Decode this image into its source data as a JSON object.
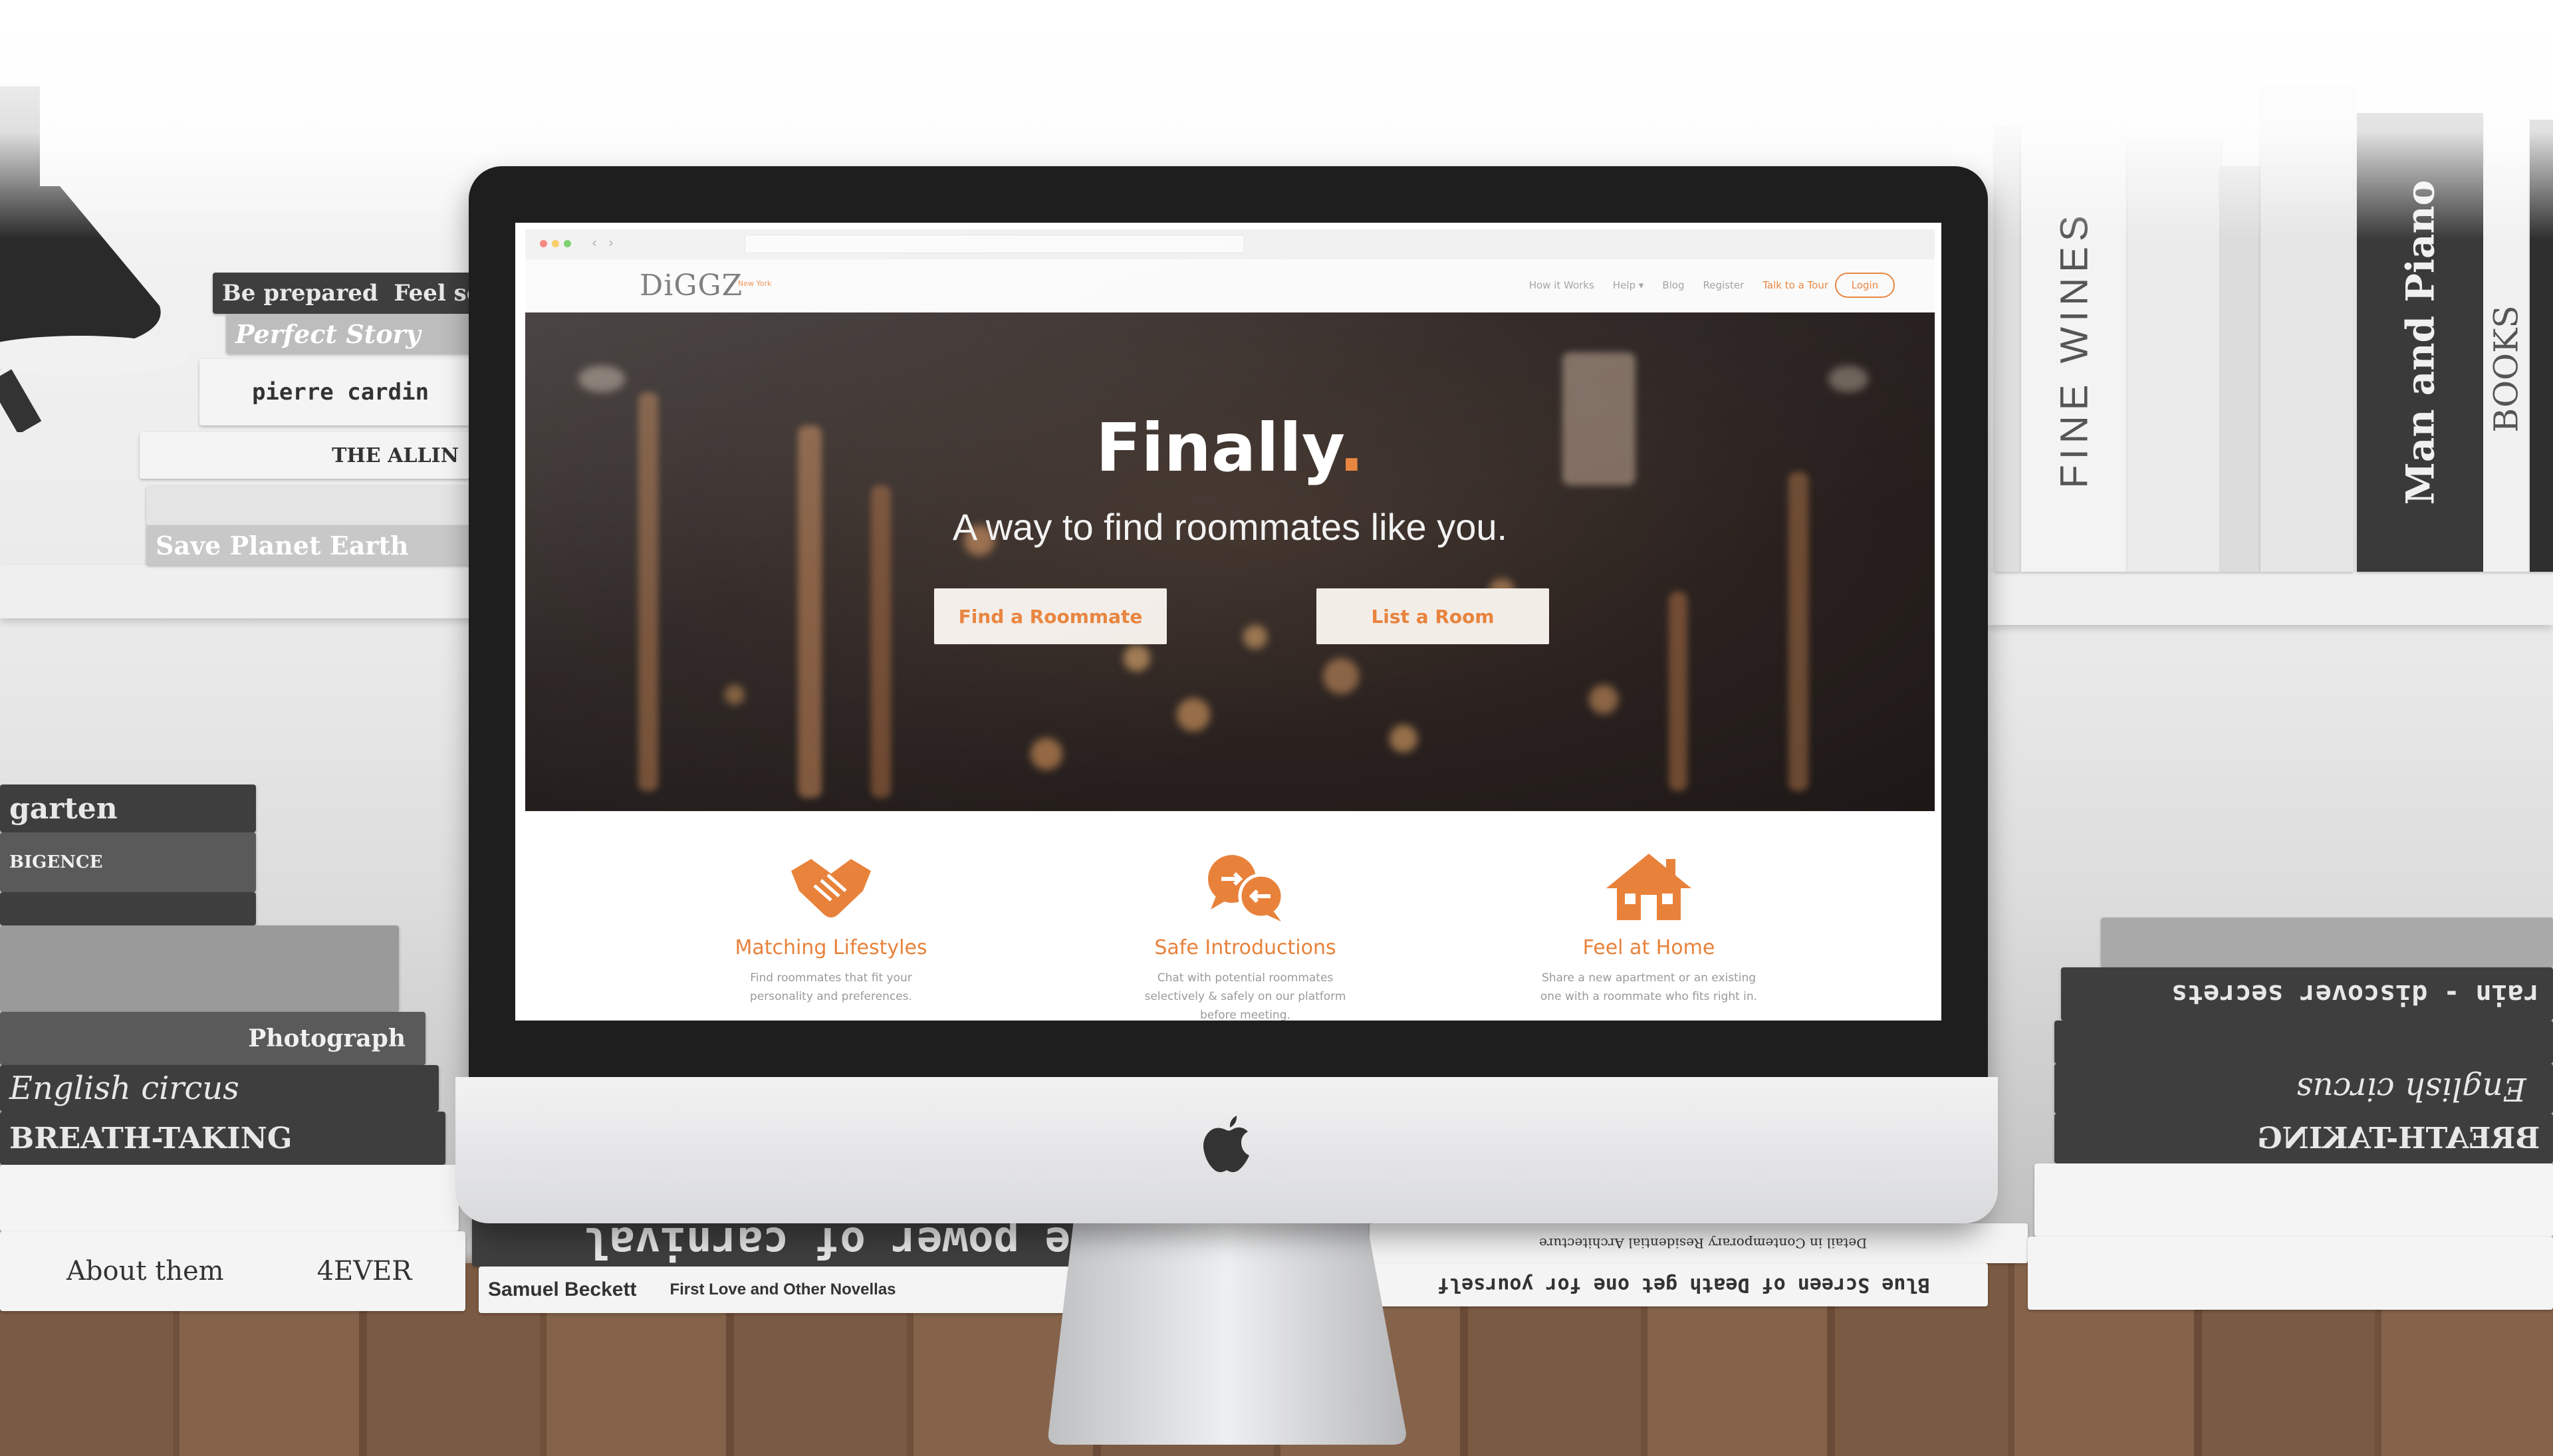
{
  "scene": {
    "left_books": [
      "Be prepared",
      "Feel secure",
      "Perfect Story",
      "pierre cardin",
      "THE ALLIN",
      "Save Planet Earth",
      "garten",
      "BIGENCE",
      "Photograph",
      "English circus",
      "BREATH-TAKING",
      "About them",
      "4EVER",
      "e power of carnival",
      "Samuel Beckett",
      "First Love and Other Novellas"
    ],
    "right_books": [
      "FINE WINES",
      "Man and Piano",
      "BOOKS",
      "rain - discover secrets",
      "English circus",
      "BREATH-TAKING",
      "Blue Screen of Death get one for yourself",
      "Detail in Contemporary Residential Architecture"
    ]
  },
  "browser": {
    "brand_label": "DiGGZ",
    "brand_sub": "New York"
  },
  "nav": {
    "items": [
      "How it Works",
      "Help ▾",
      "Blog",
      "Register",
      "Talk to a Tour"
    ],
    "login_label": "Login"
  },
  "hero": {
    "title": "Finally",
    "title_accent": ".",
    "subtitle": "A way to find roommates like you.",
    "primary_button": "Find a Roommate",
    "secondary_button": "List a Room"
  },
  "features": [
    {
      "icon": "handshake-icon",
      "title": "Matching Lifestyles",
      "desc": "Find roommates that fit your personality and preferences."
    },
    {
      "icon": "chat-icon",
      "title": "Safe Introductions",
      "desc": "Chat with potential roommates selectively & safely on our platform before meeting."
    },
    {
      "icon": "home-icon",
      "title": "Feel at Home",
      "desc": "Share a new apartment or an existing one with a roommate who fits right in."
    }
  ],
  "colors": {
    "accent": "#e8823b",
    "screen_bezel": "#1e1e1f",
    "desk": "#7b5a43"
  }
}
